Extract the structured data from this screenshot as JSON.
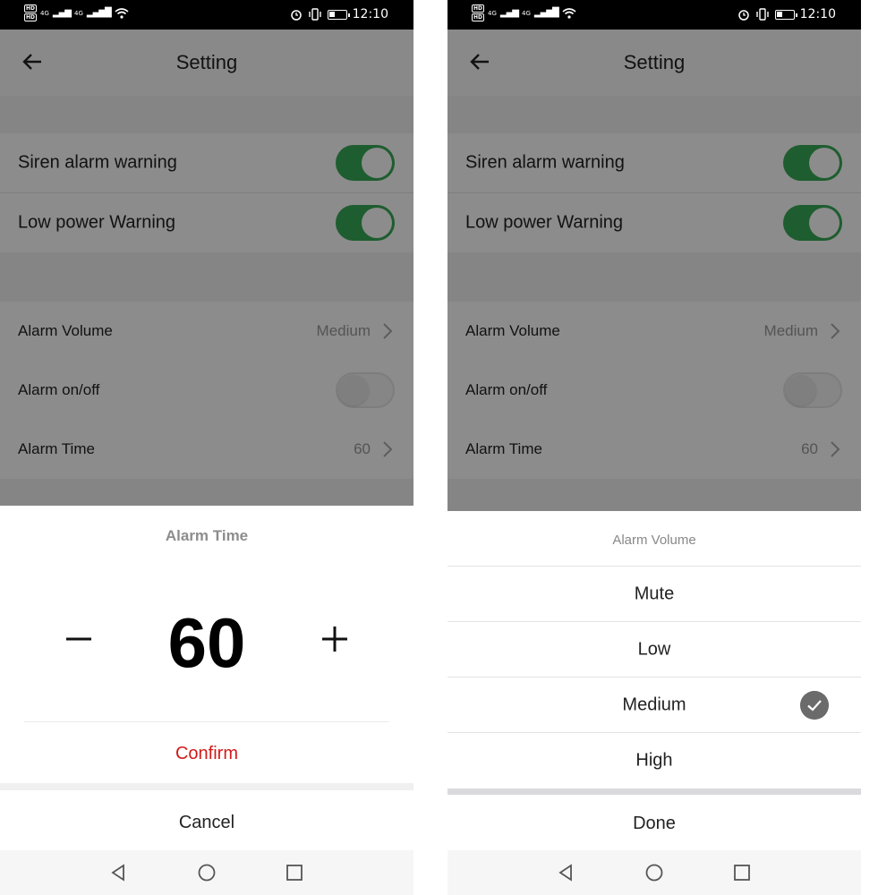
{
  "status_bar": {
    "hd1": "HD",
    "hd2": "HD",
    "net": "4G",
    "net2": "4G",
    "time": "12:10",
    "battery_level": 0.35
  },
  "header": {
    "title": "Setting"
  },
  "settings": {
    "siren_alarm_warning": {
      "label": "Siren alarm warning",
      "enabled": true
    },
    "low_power_warning": {
      "label": "Low power Warning",
      "enabled": true
    },
    "alarm_volume": {
      "label": "Alarm Volume",
      "value": "Medium"
    },
    "alarm_onoff": {
      "label": "Alarm on/off",
      "enabled": false
    },
    "alarm_time": {
      "label": "Alarm Time",
      "value": "60"
    }
  },
  "alarm_time_dialog": {
    "title": "Alarm Time",
    "minus_label": "−",
    "plus_label": "+",
    "value": "60",
    "confirm_label": "Confirm",
    "cancel_label": "Cancel"
  },
  "alarm_volume_dialog": {
    "title": "Alarm Volume",
    "options": [
      "Mute",
      "Low",
      "Medium",
      "High"
    ],
    "selected": "Medium",
    "done_label": "Done"
  },
  "colors": {
    "toggle_on": "#37a957",
    "confirm": "#d11a1a",
    "check": "#6b6b6b"
  },
  "icons": {
    "back": "arrow-left-icon",
    "chevron": "chevron-right-icon",
    "check": "check-circle-icon",
    "nav_back": "triangle-back-icon",
    "nav_home": "circle-home-icon",
    "nav_recent": "square-recent-icon"
  }
}
